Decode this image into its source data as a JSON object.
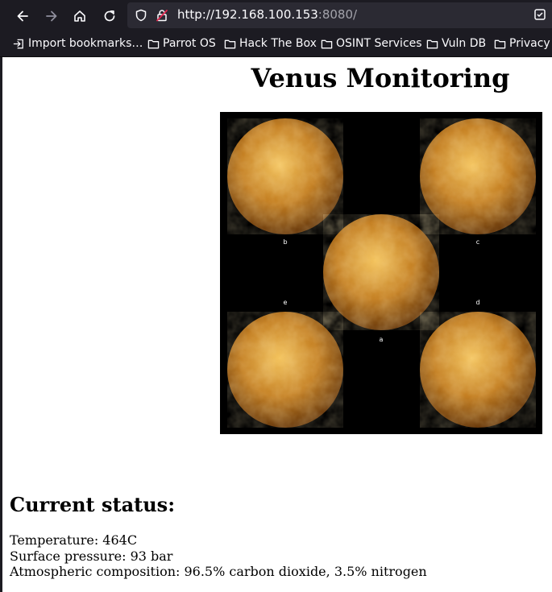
{
  "browser": {
    "url_host": "http://192.168.100.153",
    "url_port": ":8080/",
    "bookmarks": [
      {
        "label": "Import bookmarks…",
        "icon": "import-icon"
      },
      {
        "label": "Parrot OS",
        "icon": "folder-icon"
      },
      {
        "label": "Hack The Box",
        "icon": "folder-icon"
      },
      {
        "label": "OSINT Services",
        "icon": "folder-icon"
      },
      {
        "label": "Vuln DB",
        "icon": "folder-icon"
      },
      {
        "label": "Privacy a",
        "icon": "folder-icon"
      }
    ]
  },
  "page": {
    "title": "Venus Monitoring",
    "image_labels": [
      "b",
      "c",
      "a",
      "e",
      "d"
    ],
    "status_heading": "Current status:",
    "status_lines": [
      "Temperature: 464C",
      "Surface pressure: 93 bar",
      "Atmospheric composition: 96.5% carbon dioxide, 3.5% nitrogen"
    ]
  },
  "colors": {
    "chrome_bg": "#1c1b22",
    "urlbar_bg": "#2b2a33",
    "chrome_text": "#fbfbfe",
    "port_text": "#a3a3ab",
    "venus_light": "#f4c45e",
    "venus_mid": "#c47f22",
    "venus_dark": "#6a3a0c"
  }
}
